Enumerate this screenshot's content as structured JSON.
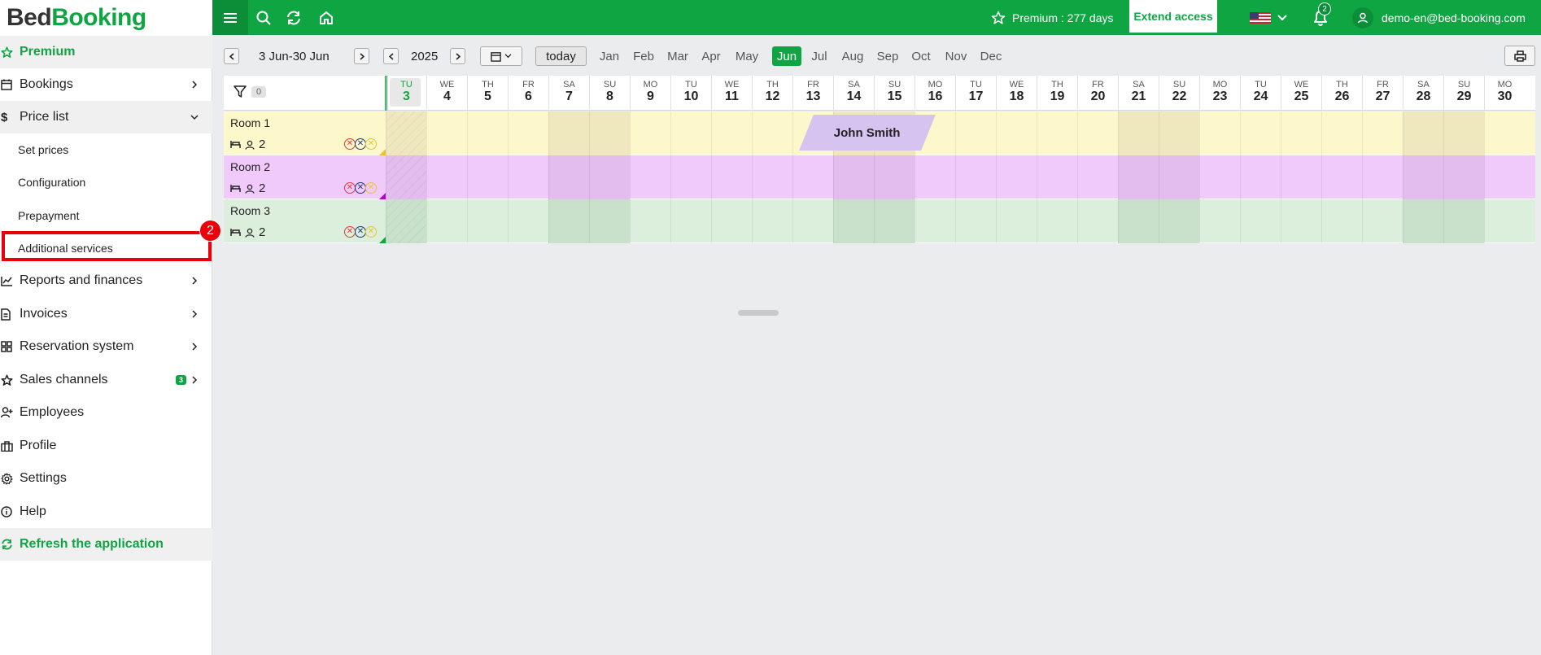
{
  "brand": {
    "part1": "Bed",
    "part2": "Booking"
  },
  "topbar": {
    "premium_text": "Premium : 277 days",
    "extend_label": "Extend access",
    "notifications_count": "2",
    "user_email": "demo-en@bed-booking.com"
  },
  "sidebar": {
    "premium": "Premium",
    "bookings": "Bookings",
    "price_list": "Price list",
    "set_prices": "Set prices",
    "configuration": "Configuration",
    "prepayment": "Prepayment",
    "additional_services": "Additional services",
    "reports": "Reports and finances",
    "invoices": "Invoices",
    "reservation_system": "Reservation system",
    "sales_channels": "Sales channels",
    "sales_channels_badge": "3",
    "employees": "Employees",
    "profile": "Profile",
    "settings": "Settings",
    "help": "Help",
    "refresh": "Refresh the application",
    "highlight_badge": "2"
  },
  "toolbar": {
    "range": "3 Jun-30 Jun",
    "year": "2025",
    "today": "today",
    "months": [
      "Jan",
      "Feb",
      "Mar",
      "Apr",
      "May",
      "Jun",
      "Jul",
      "Aug",
      "Sep",
      "Oct",
      "Nov",
      "Dec"
    ],
    "active_month": "Jun"
  },
  "grid": {
    "filter_count": "0",
    "days": [
      {
        "dn": "TU",
        "dd": "3"
      },
      {
        "dn": "WE",
        "dd": "4"
      },
      {
        "dn": "TH",
        "dd": "5"
      },
      {
        "dn": "FR",
        "dd": "6"
      },
      {
        "dn": "SA",
        "dd": "7"
      },
      {
        "dn": "SU",
        "dd": "8"
      },
      {
        "dn": "MO",
        "dd": "9"
      },
      {
        "dn": "TU",
        "dd": "10"
      },
      {
        "dn": "WE",
        "dd": "11"
      },
      {
        "dn": "TH",
        "dd": "12"
      },
      {
        "dn": "FR",
        "dd": "13"
      },
      {
        "dn": "SA",
        "dd": "14"
      },
      {
        "dn": "SU",
        "dd": "15"
      },
      {
        "dn": "MO",
        "dd": "16"
      },
      {
        "dn": "TU",
        "dd": "17"
      },
      {
        "dn": "WE",
        "dd": "18"
      },
      {
        "dn": "TH",
        "dd": "19"
      },
      {
        "dn": "FR",
        "dd": "20"
      },
      {
        "dn": "SA",
        "dd": "21"
      },
      {
        "dn": "SU",
        "dd": "22"
      },
      {
        "dn": "MO",
        "dd": "23"
      },
      {
        "dn": "TU",
        "dd": "24"
      },
      {
        "dn": "WE",
        "dd": "25"
      },
      {
        "dn": "TH",
        "dd": "26"
      },
      {
        "dn": "FR",
        "dd": "27"
      },
      {
        "dn": "SA",
        "dd": "28"
      },
      {
        "dn": "SU",
        "dd": "29"
      },
      {
        "dn": "MO",
        "dd": "30"
      }
    ],
    "rooms": [
      {
        "name": "Room 1",
        "guests": "2",
        "color": "#fdf8cc",
        "weekend": "#efe8bf",
        "corner": "#e8c433"
      },
      {
        "name": "Room 2",
        "guests": "2",
        "color": "#f1cafc",
        "weekend": "#e2bdee",
        "corner": "#b000d6"
      },
      {
        "name": "Room 3",
        "guests": "2",
        "color": "#dcefdd",
        "weekend": "#c9e1cb",
        "corner": "#10a543"
      }
    ],
    "booking": {
      "guest": "John Smith",
      "color": "#d6c3f0"
    }
  }
}
